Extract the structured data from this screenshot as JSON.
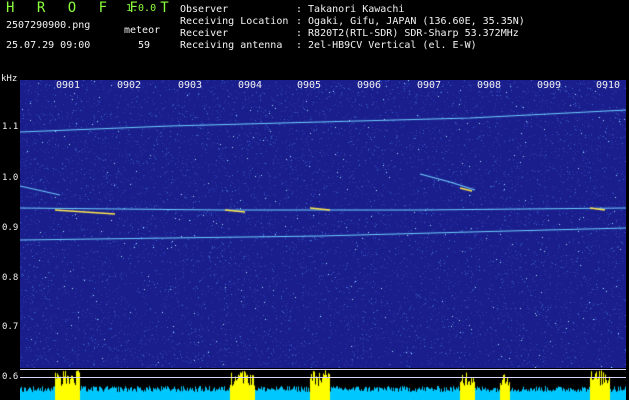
{
  "header": {
    "app_title": "H R O F F T",
    "version": "1.0.0",
    "filename": "2507290900.png",
    "datetime": "25.07.29 09:00",
    "meteor_label": "meteor",
    "meteor_count": "59"
  },
  "station_info": [
    {
      "label": "Observer",
      "value": ": Takanori Kawachi"
    },
    {
      "label": "Receiving Location",
      "value": ": Ogaki, Gifu, JAPAN (136.60E, 35.35N)"
    },
    {
      "label": "Receiver",
      "value": ": R820T2(RTL-SDR) SDR-Sharp 53.372MHz"
    },
    {
      "label": "Receiving antenna",
      "value": ": 2el-HB9CV Vertical (el. E-W)"
    }
  ],
  "spectrogram": {
    "y_unit": "kHz",
    "x_ticks": [
      "0901",
      "0902",
      "0903",
      "0904",
      "0905",
      "0906",
      "0907",
      "0908",
      "0909",
      "0910"
    ],
    "y_ticks": [
      "1.1",
      "1.0",
      "0.9",
      "0.8",
      "0.7",
      "0.6"
    ],
    "background_color": "#1a1e8c",
    "signal_color": "#6fd0ff",
    "strong_color": "#ffe84a",
    "strip_color": "#00c8ff",
    "strip_peak_color": "#ffff00"
  }
}
